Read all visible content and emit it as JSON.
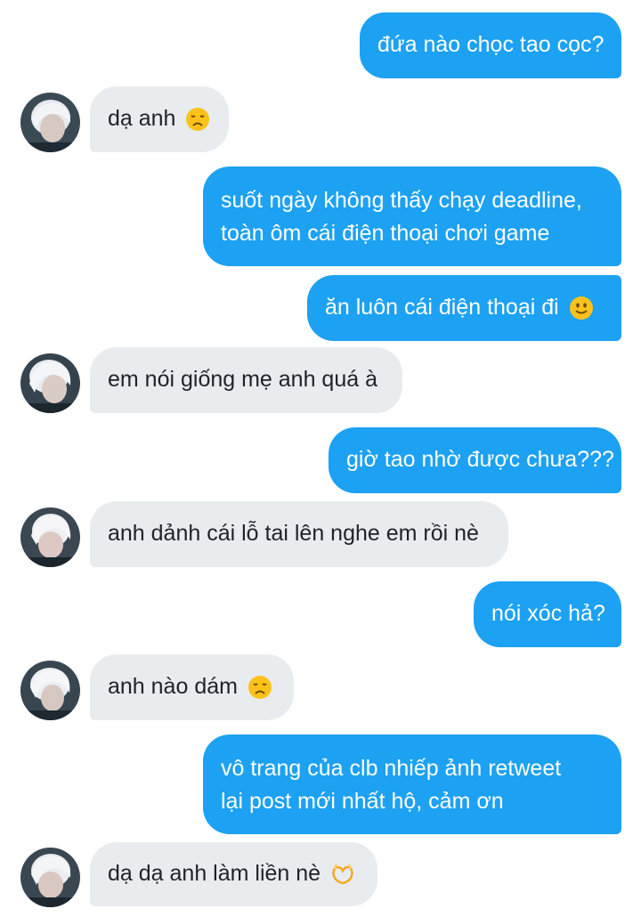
{
  "colors": {
    "outgoing_bubble": "#1da1f2",
    "incoming_bubble": "#e8ecef",
    "outgoing_text": "#ffffff",
    "incoming_text": "#1f2328"
  },
  "messages": [
    {
      "direction": "outgoing",
      "lines": [
        "đứa nào chọc tao cọc?"
      ]
    },
    {
      "direction": "incoming",
      "lines": [
        "dạ anh"
      ],
      "emoji": "disappointed-face-icon"
    },
    {
      "direction": "outgoing",
      "lines": [
        "suốt ngày không thấy chạy deadline,",
        "toàn ôm cái điện thoại chơi game"
      ]
    },
    {
      "direction": "outgoing",
      "lines": [
        "ăn luôn cái điện thoại đi"
      ],
      "emoji": "slightly-smiling-face-icon"
    },
    {
      "direction": "incoming",
      "lines": [
        "em nói giống mẹ anh quá à"
      ]
    },
    {
      "direction": "outgoing",
      "lines": [
        "giờ tao nhờ được chưa???"
      ]
    },
    {
      "direction": "incoming",
      "lines": [
        "anh dảnh cái lỗ tai lên nghe em rồi nè"
      ]
    },
    {
      "direction": "outgoing",
      "lines": [
        "nói xóc hả?"
      ]
    },
    {
      "direction": "incoming",
      "lines": [
        "anh nào dám"
      ],
      "emoji": "disappointed-face-icon"
    },
    {
      "direction": "outgoing",
      "lines": [
        "vô trang của clb nhiếp ảnh retweet",
        "lại post mới nhất hộ, cảm ơn"
      ]
    },
    {
      "direction": "incoming",
      "lines": [
        "dạ dạ anh làm liền nè"
      ],
      "emoji": "heart-hands-icon"
    }
  ]
}
